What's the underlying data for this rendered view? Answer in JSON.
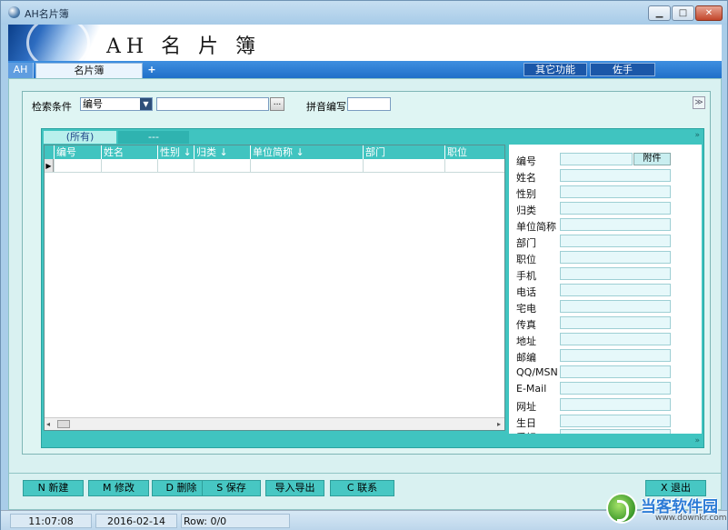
{
  "window": {
    "title": "AH名片簿",
    "min_glyph": "▁",
    "max_glyph": "□",
    "close_glyph": "✕"
  },
  "banner": {
    "brand": "AH 名 片 簿"
  },
  "tabs": {
    "ah": "AH",
    "card": "名片簿",
    "plus": "+"
  },
  "top_buttons": {
    "other": "其它功能",
    "assistant": "佐手"
  },
  "search": {
    "label": "检索条件",
    "field_value": "编号",
    "dropdown_glyph": "▼",
    "query_value": "",
    "browse_label": "...",
    "pinyin_label": "拼音编写",
    "pinyin_value": "",
    "collapse_glyph": "≫"
  },
  "categories": {
    "all": "(所有)",
    "dash": "---",
    "arrow": "»"
  },
  "grid": {
    "columns": [
      "编号",
      "姓名",
      "性别 ↓",
      "归类 ↓",
      "单位简称 ↓",
      "部门",
      "职位"
    ],
    "row_marker": "▶",
    "rows": [],
    "scroll_left": "◂",
    "scroll_right": "▸"
  },
  "detail": {
    "attach_label": "附件",
    "fields": [
      "编号",
      "姓名",
      "性别",
      "归类",
      "单位简称",
      "部门",
      "职位",
      "手机",
      "电话",
      "宅电",
      "传真",
      "地址",
      "邮编",
      "QQ/MSN",
      "E-Mail",
      "网址",
      "生日",
      "爱好"
    ],
    "arrow": "»"
  },
  "actions": {
    "new": "N 新建",
    "edit": "M 修改",
    "delete": "D 删除",
    "save": "S 保存",
    "import_export": "导入导出",
    "relation": "C 联系",
    "exit": "X 退出"
  },
  "status": {
    "time": "11:07:08",
    "date": "2016-02-14",
    "row": "Row: 0/0"
  },
  "watermark": {
    "text": "当客软件园",
    "sub": "www.downkr.com"
  }
}
